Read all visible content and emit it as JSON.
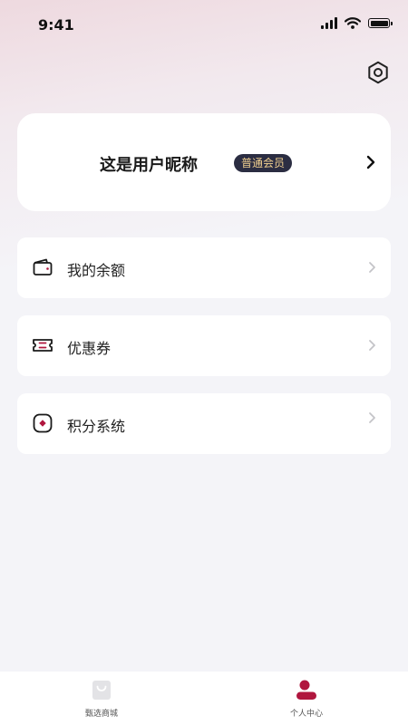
{
  "status_bar": {
    "time": "9:41"
  },
  "profile": {
    "nickname": "这是用户昵称",
    "member_level": "普通会员"
  },
  "menu": [
    {
      "label": "我的余额",
      "icon": "wallet-icon"
    },
    {
      "label": "优惠券",
      "icon": "coupon-icon"
    },
    {
      "label": "积分系统",
      "icon": "points-icon"
    }
  ],
  "tabs": [
    {
      "label": "甄选商城",
      "icon": "shopping-bag-icon",
      "active": false
    },
    {
      "label": "个人中心",
      "icon": "user-icon",
      "active": true
    }
  ],
  "colors": {
    "accent": "#b0163e",
    "badge_bg": "#2b2d42",
    "badge_text": "#f0cf8f",
    "inactive_icon": "#e3e3e6"
  }
}
